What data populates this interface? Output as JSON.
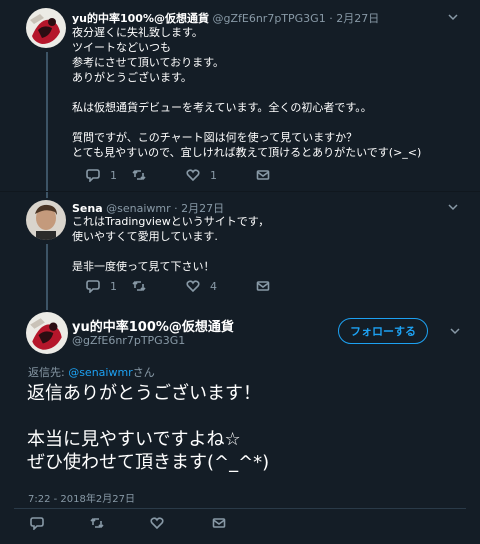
{
  "tweet1": {
    "name": "yu的中率100%@仮想通貨",
    "handle": "@gZfE6nr7pTPG3G1",
    "sep": "·",
    "date": "2月27日",
    "text": "夜分遅くに失礼致します。\nツイートなどいつも\n参考にさせて頂いております。\nありがとうございます。\n\n私は仮想通貨デビューを考えています。全くの初心者です。。\n\n質問ですが、このチャート図は何を使って見ていますか？\nとても見やすいので、宜しければ教えて頂けるとありがたいです(>_<)",
    "reply_count": "1",
    "retweet_count": "",
    "like_count": "1"
  },
  "tweet2": {
    "name": "Sena",
    "handle": "@senaiwmr",
    "sep": "·",
    "date": "2月27日",
    "text": "これはTradingviewというサイトです，\n使いやすくて愛用しています.\n\n是非一度使って見て下さい！",
    "reply_count": "1",
    "retweet_count": "",
    "like_count": "4"
  },
  "main": {
    "name": "yu的中率100%@仮想通貨",
    "handle": "@gZfE6nr7pTPG3G1",
    "follow_label": "フォローする",
    "reply_to_prefix": "返信先: ",
    "reply_to_handle": "@senaiwmr",
    "reply_to_suffix": "さん",
    "text": "返信ありがとうございます！\n\n本当に見やすいですよね☆\nぜひ使わせて頂きます(^_^*)",
    "timestamp": "7:22 - 2018年2月27日"
  },
  "colors": {
    "background": "#141d26",
    "accent": "#1da1f2",
    "muted": "#8899a6"
  },
  "icons": [
    "chevron-down-icon",
    "reply-icon",
    "retweet-icon",
    "like-icon",
    "message-icon"
  ]
}
